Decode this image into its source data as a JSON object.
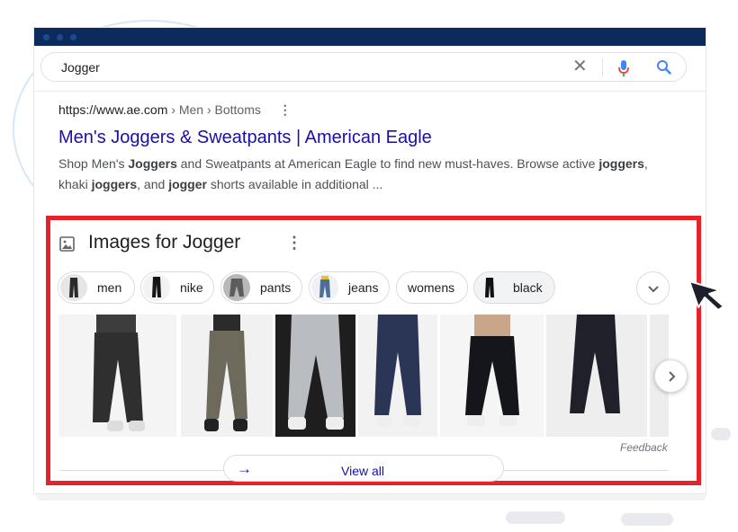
{
  "search": {
    "query": "Jogger"
  },
  "result": {
    "breadcrumb_url": "https://www.ae.com",
    "breadcrumb_path": " › Men › Bottoms",
    "title": "Men's Joggers & Sweatpants | American Eagle",
    "snippet": {
      "s1": "Shop Men's ",
      "b1": "Joggers",
      "s2": " and Sweatpants at American Eagle to find new must-haves. Browse active ",
      "b2": "joggers",
      "s3": ", khaki ",
      "b3": "joggers",
      "s4": ", and ",
      "b4": "jogger",
      "s5": " shorts available in additional ..."
    }
  },
  "images_section": {
    "title": "Images for Jogger",
    "chips": [
      {
        "label": "men"
      },
      {
        "label": "nike"
      },
      {
        "label": "pants"
      },
      {
        "label": "jeans"
      },
      {
        "label": "womens"
      },
      {
        "label": "black"
      }
    ],
    "feedback": "Feedback",
    "view_all": "View all"
  },
  "colors": {
    "titlebar": "#0c2a5b",
    "link": "#1a0dab",
    "highlight_border": "#e5232b",
    "mic_blue": "#4285f4",
    "mic_red": "#ea4335"
  }
}
